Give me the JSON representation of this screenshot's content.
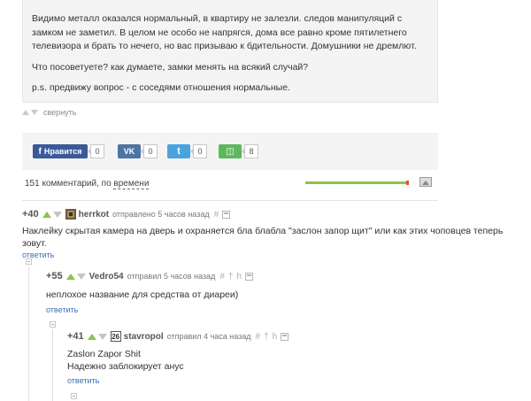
{
  "post": {
    "paragraphs": [
      "Видимо металл оказался нормальный, в квартиру не залезли. следов манипуляций с замком не заметил. В целом не особо не напрягся, дома все равно кроме пятилетнего телевизора и брать то нечего, но вас призываю к бдительности. Домушники не дремлют.",
      "Что посоветуете? как думаете, замки менять на всякий случай?",
      "p.s. предвижу вопрос - с соседями отношения нормальные."
    ],
    "collapse_label": "свернуть"
  },
  "share": {
    "fb_label": "Нравится",
    "fb_count": "0",
    "vk_label": "VK",
    "vk_count": "0",
    "tw_label": "t",
    "tw_count": "0",
    "ok_label": "◫",
    "ok_count": "8"
  },
  "comments_header": {
    "count_text": "151 комментарий, по ",
    "sort_text": "времени",
    "progress_fraction": 0.98
  },
  "comments": [
    {
      "rating": "+40",
      "author": "herrkot",
      "meta": "отправлено 5 часов назад",
      "hash": "#",
      "body": "Наклейку скрытая камера на дверь и охраняется бла блабла \"заслон запор щит\" или как этих чоповцев теперь зовут.",
      "reply": "ответить"
    },
    {
      "rating": "+55",
      "author": "Vedro54",
      "meta": "отправил 5 часов назад",
      "hash": "#",
      "dagger": "†",
      "h": "h",
      "body": "неплохое название для средства от диареи)",
      "reply": "ответить"
    },
    {
      "rating": "+41",
      "avatar_text": "26",
      "author": "stavropol",
      "meta": "отправил 4 часа назад",
      "hash": "#",
      "dagger": "†",
      "h": "h",
      "body_line1": "Zaslon Zapor Shit",
      "body_line2": "Надежно заблокирует анус",
      "reply": "ответить"
    }
  ],
  "colors": {
    "accent_green": "#8bc34a",
    "link_blue": "#3a6fb0",
    "fb": "#3b5998",
    "vk": "#4c75a3",
    "tw": "#4aa3df",
    "ok": "#5cb85c"
  }
}
